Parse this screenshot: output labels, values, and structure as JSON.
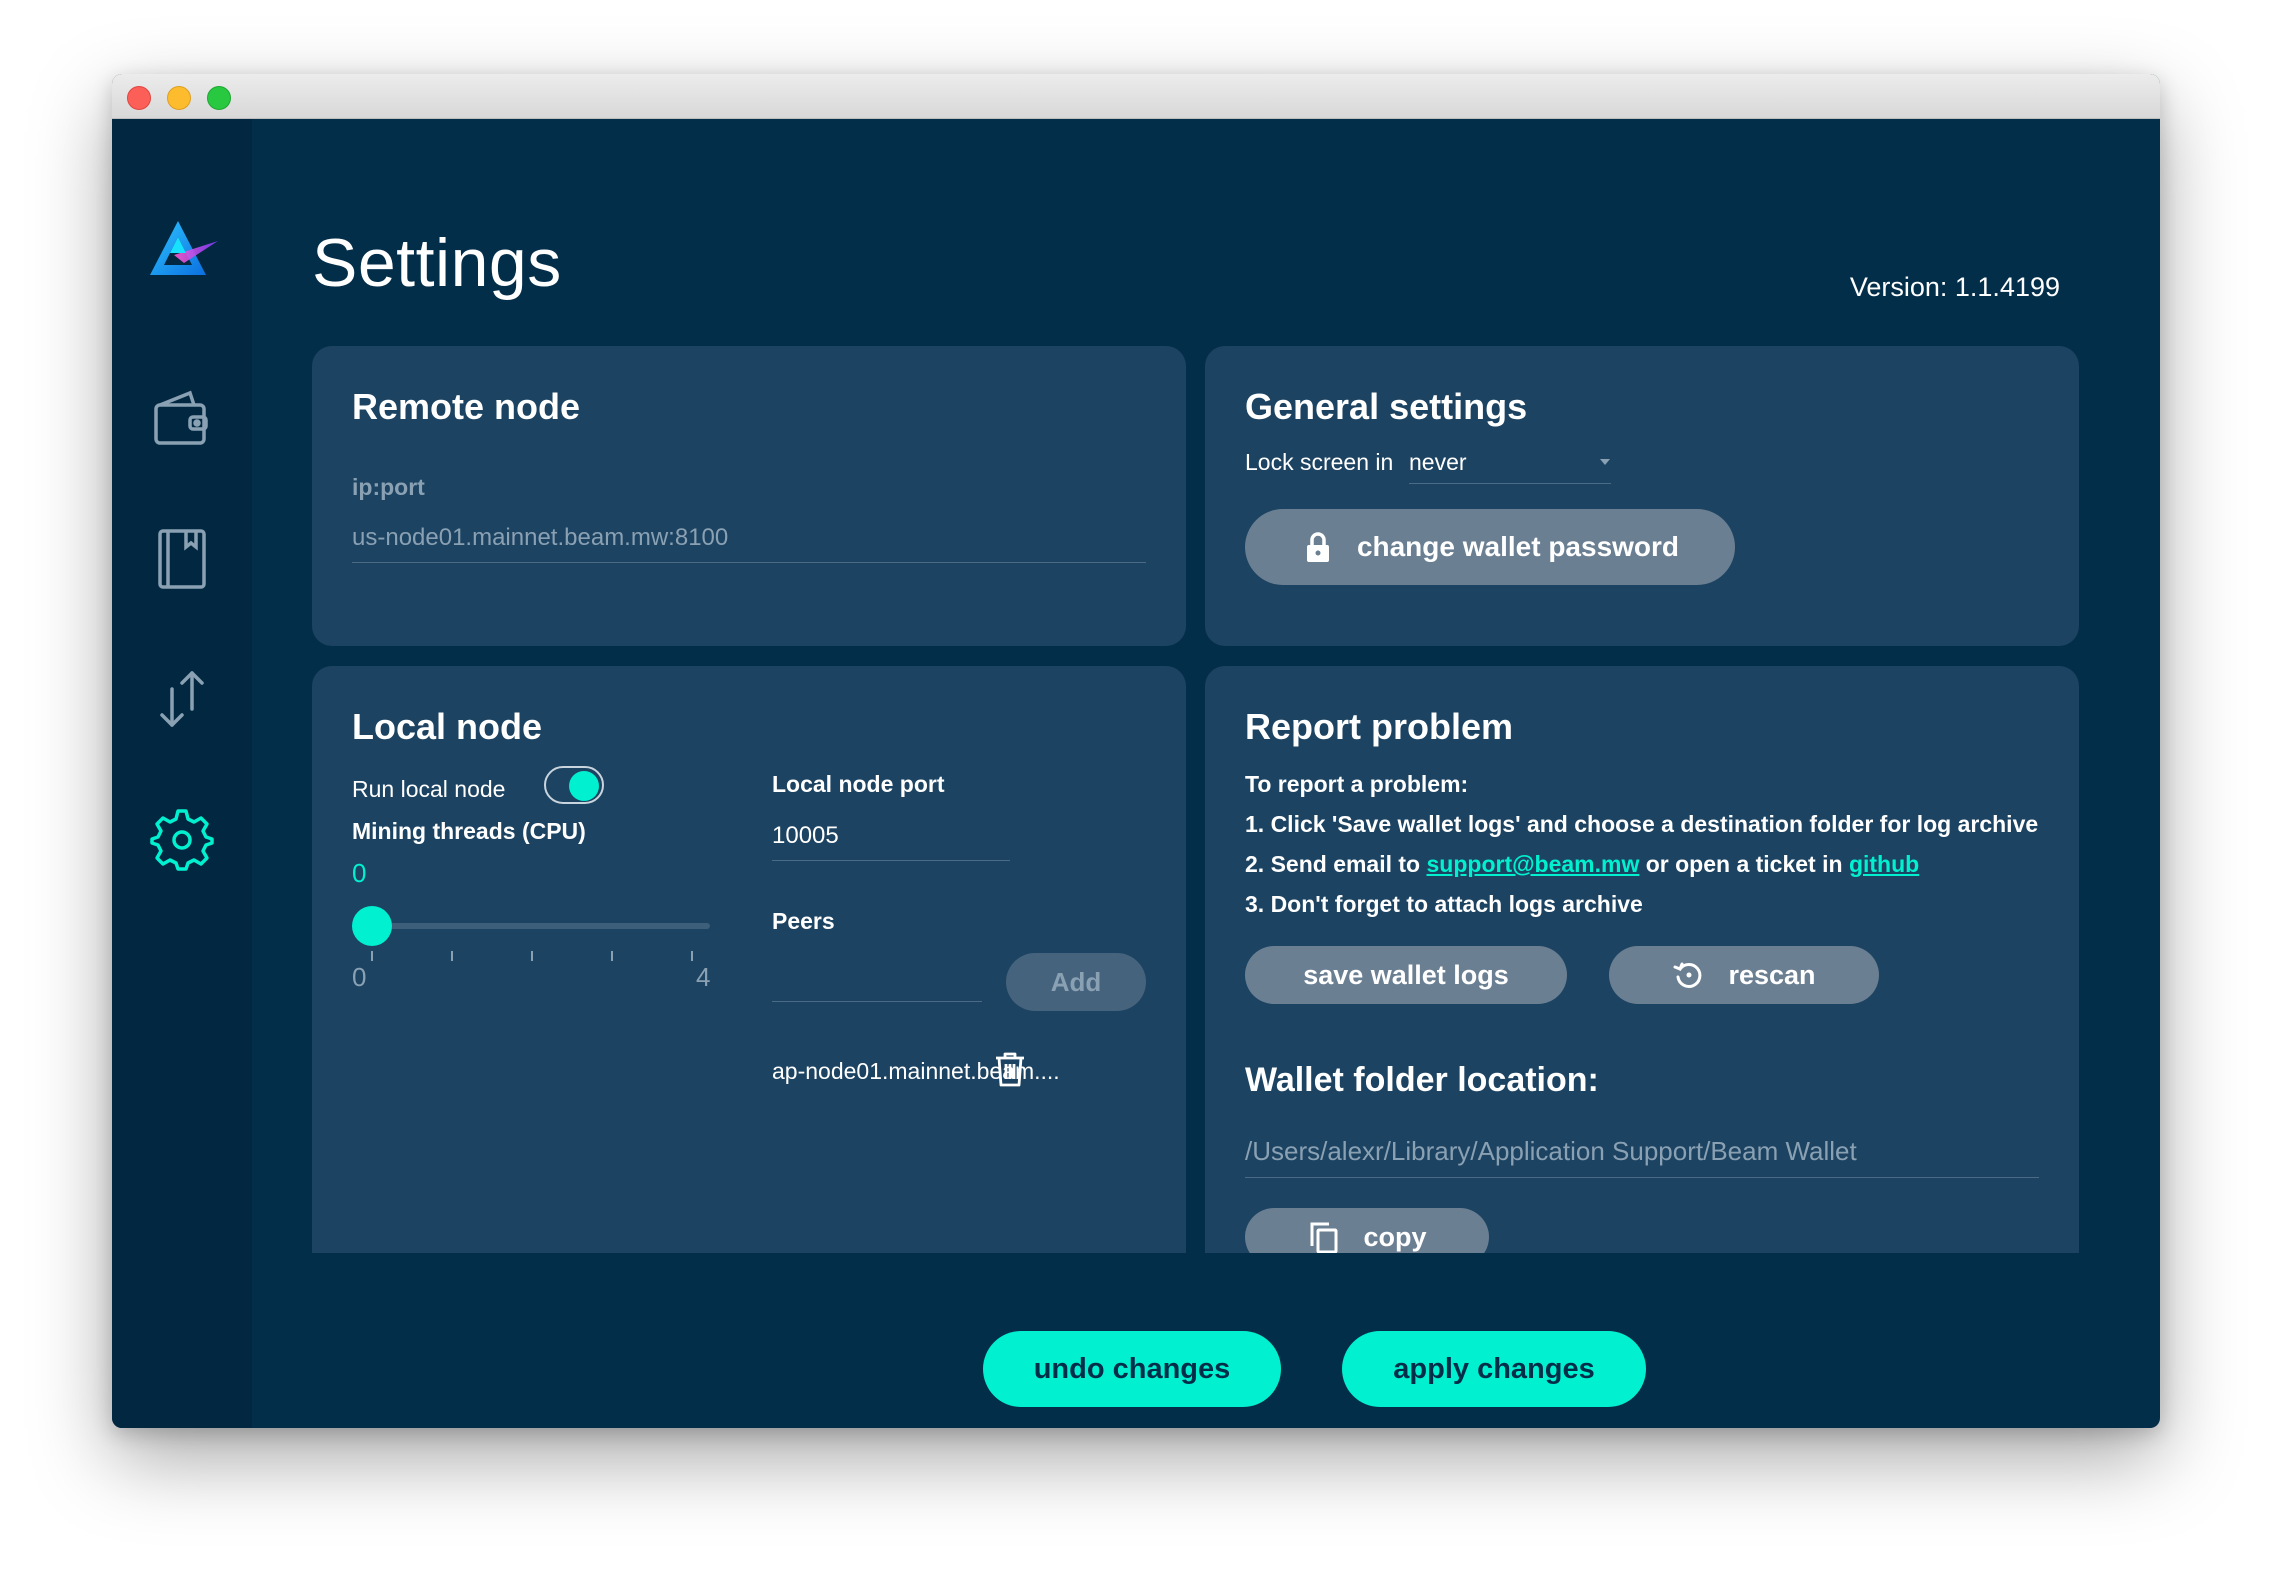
{
  "page": {
    "title": "Settings",
    "version": "Version: 1.1.4199"
  },
  "sidebar": {
    "items": [
      {
        "name": "wallet",
        "icon": "wallet-icon"
      },
      {
        "name": "address-book",
        "icon": "notebook-icon"
      },
      {
        "name": "transactions",
        "icon": "arrows-icon"
      },
      {
        "name": "settings",
        "icon": "gear-icon",
        "active": true
      }
    ]
  },
  "remote_node": {
    "title": "Remote node",
    "field_label": "ip:port",
    "address": "us-node01.mainnet.beam.mw:8100"
  },
  "general": {
    "title": "General settings",
    "lock_label": "Lock screen in",
    "lock_value": "never",
    "change_password_label": "change wallet password"
  },
  "local_node": {
    "title": "Local node",
    "run_label": "Run local node",
    "run_enabled": true,
    "mining_label": "Mining threads (CPU)",
    "mining_value": "0",
    "slider_min": "0",
    "slider_max": "4",
    "slider_fraction": 0,
    "port_label": "Local node port",
    "port_value": "10005",
    "peers_label": "Peers",
    "peer_input": "",
    "add_label": "Add",
    "peers": [
      "ap-node01.mainnet.beam...."
    ]
  },
  "report": {
    "title": "Report problem",
    "intro": "To report a problem:",
    "step1": "1. Click 'Save wallet logs' and choose a destination folder for log archive",
    "step2_a": "2. Send email to ",
    "email": "support@beam.mw",
    "step2_b": " or open a ticket in ",
    "github": "github",
    "step3": "3. Don't forget to attach logs archive",
    "save_logs_label": "save wallet logs",
    "rescan_label": "rescan",
    "folder_title": "Wallet folder location:",
    "folder_path": "/Users/alexr/Library/Application Support/Beam Wallet",
    "copy_label": "copy"
  },
  "footer": {
    "undo_label": "undo changes",
    "apply_label": "apply changes"
  },
  "colors": {
    "accent": "#00f0d0",
    "background": "#032e49",
    "panel": "#1c4361",
    "sidebar": "#022841"
  }
}
